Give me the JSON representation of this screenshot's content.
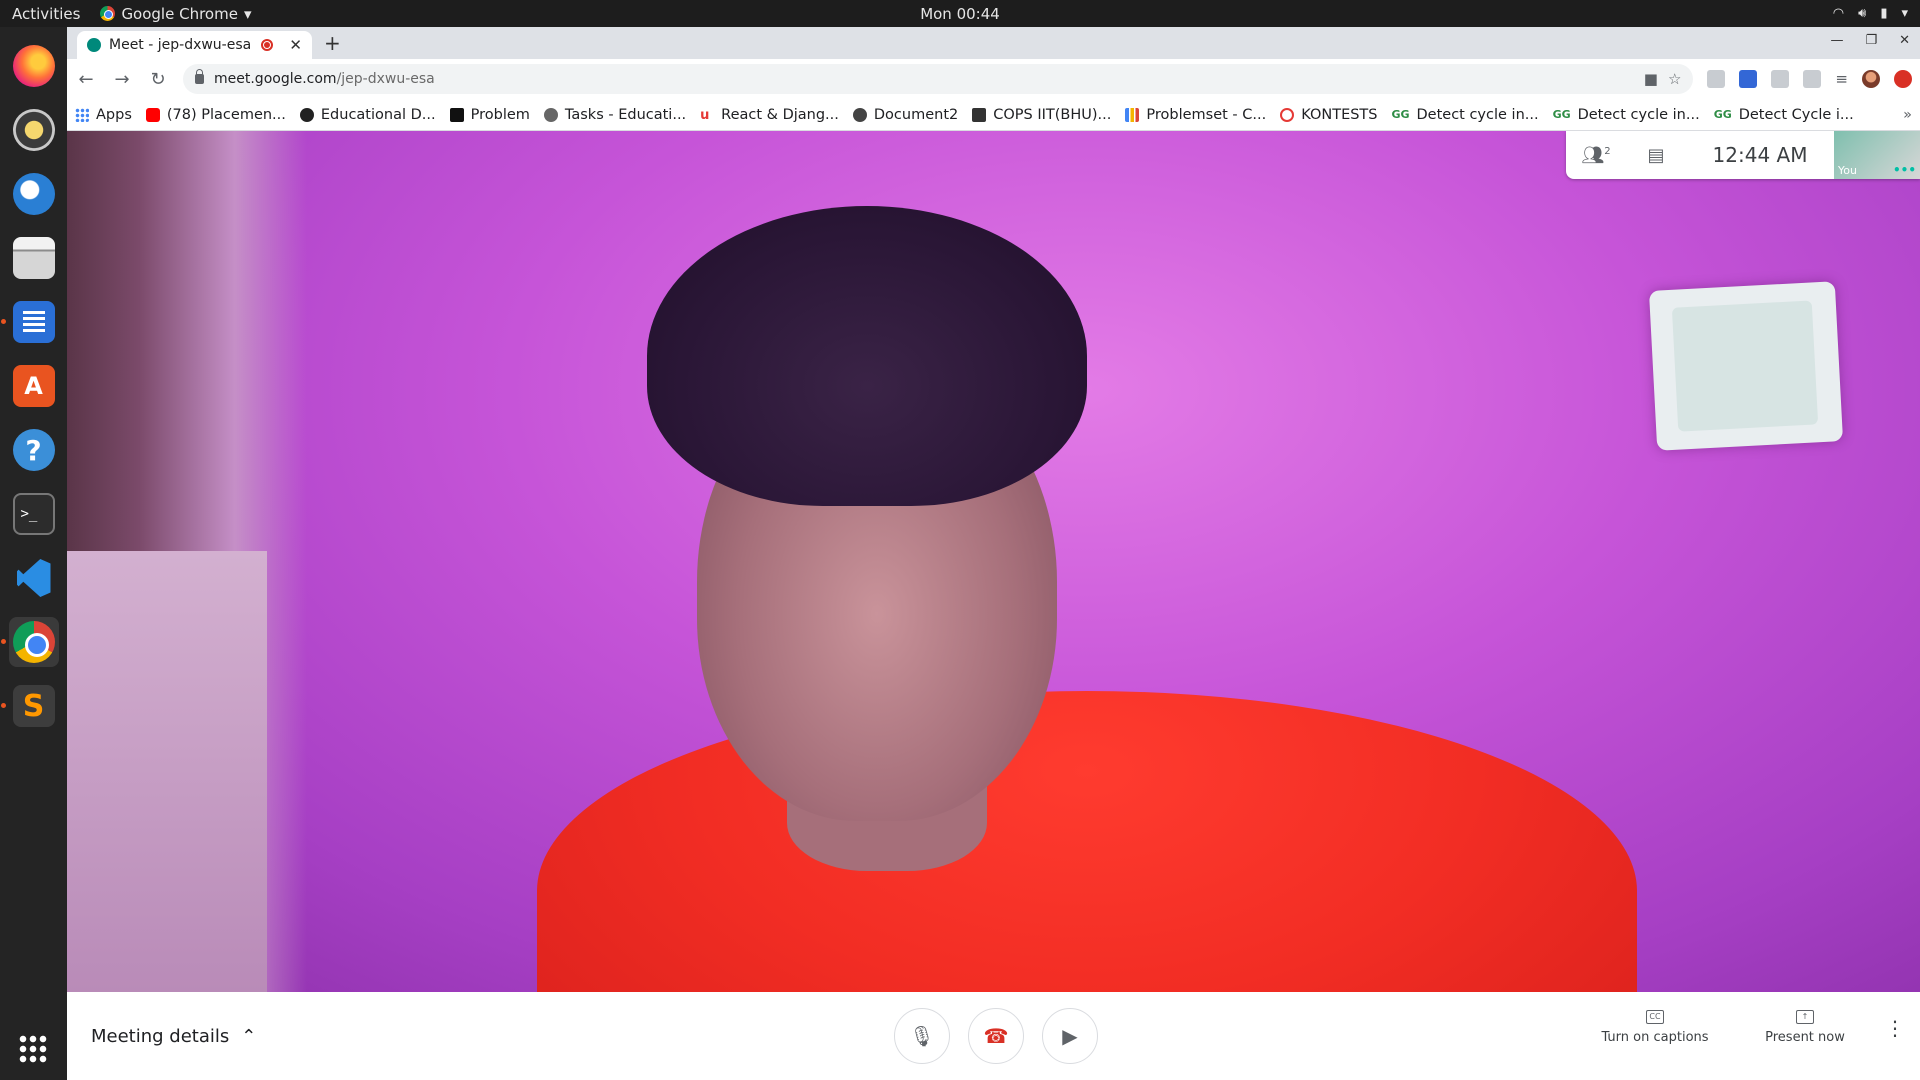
{
  "topbar": {
    "activities": "Activities",
    "app_menu": "Google Chrome",
    "clock": "Mon 00:44"
  },
  "dock": {
    "items": [
      "firefox-icon",
      "rhythmbox-icon",
      "thunderbird-icon",
      "files-icon",
      "libreoffice-writer-icon",
      "ubuntu-software-icon",
      "help-icon",
      "terminal-icon",
      "vscode-icon",
      "chrome-icon",
      "sublime-text-icon"
    ],
    "active": "chrome-icon"
  },
  "browser": {
    "tab_title": "Meet - jep-dxwu-esa",
    "url_host": "meet.google.com",
    "url_path": "/jep-dxwu-esa",
    "bookmarks": [
      "Apps",
      "(78) Placemen...",
      "Educational D...",
      "Problem",
      "Tasks - Educati...",
      "React & Djang...",
      "Document2",
      "COPS IIT(BHU)...",
      "Problemset - C...",
      "KONTESTS",
      "Detect cycle in...",
      "Detect cycle in...",
      "Detect Cycle i..."
    ]
  },
  "meet": {
    "participant_count": "2",
    "time": "12:44  AM",
    "self_label": "You",
    "meeting_details": "Meeting details",
    "captions_label": "Turn on captions",
    "present_label": "Present now"
  },
  "colors": {
    "accent": "#1a73e8",
    "hangup": "#d93025",
    "ubuntu_orange": "#e95420"
  }
}
